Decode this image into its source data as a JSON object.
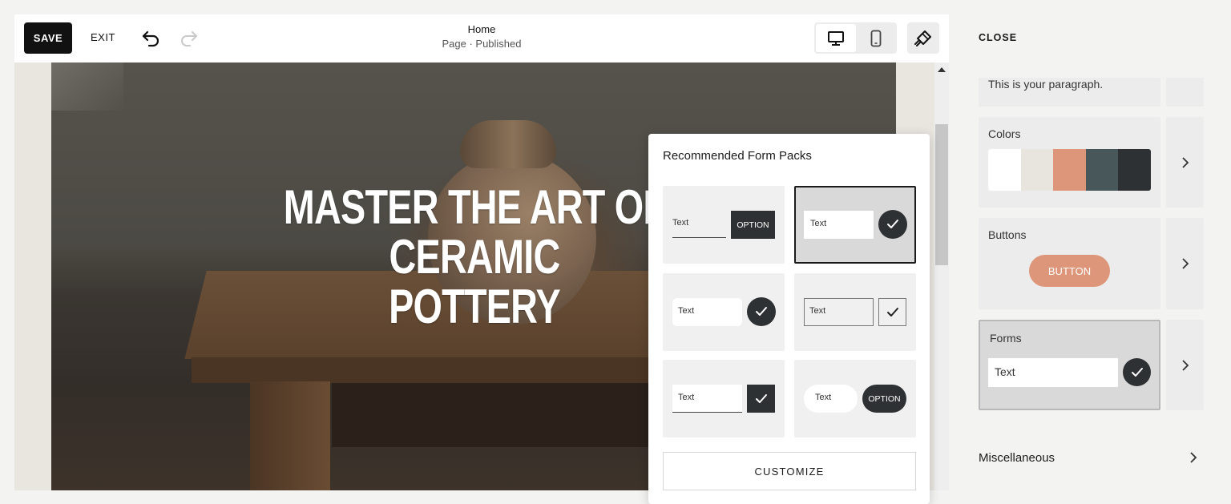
{
  "toolbar": {
    "save_label": "SAVE",
    "exit_label": "EXIT",
    "undo_icon": "undo-icon",
    "redo_icon": "redo-icon",
    "page_title": "Home",
    "page_status": "Page · Published",
    "desktop_icon": "desktop-icon",
    "mobile_icon": "mobile-icon",
    "design_icon": "paintbrush-icon"
  },
  "hero": {
    "heading_line1": "MASTER THE ART OF CERAMIC",
    "heading_line2": "POTTERY"
  },
  "form_packs": {
    "title": "Recommended Form Packs",
    "packs": [
      {
        "field_text": "Text",
        "action": "OPTION",
        "style": "underline-field, square option button"
      },
      {
        "field_text": "Text",
        "action": "check",
        "style": "box field, round check",
        "selected": true
      },
      {
        "field_text": "Text",
        "action": "check",
        "style": "rounded field, round check"
      },
      {
        "field_text": "Text",
        "action": "check",
        "style": "outlined field, outlined square check"
      },
      {
        "field_text": "Text",
        "action": "check",
        "style": "underline field, square dark check"
      },
      {
        "field_text": "Text",
        "action": "OPTION",
        "style": "pill field, pill option"
      }
    ],
    "customize_label": "CUSTOMIZE"
  },
  "panel": {
    "close_label": "CLOSE",
    "paragraph_text": "This is your paragraph.",
    "colors_label": "Colors",
    "colors": [
      "#ffffff",
      "#e8e5df",
      "#dd9679",
      "#48585a",
      "#2e3133"
    ],
    "buttons_label": "Buttons",
    "button_sample": "BUTTON",
    "forms_label": "Forms",
    "forms_field": "Text",
    "misc_label": "Miscellaneous"
  },
  "accent": {
    "dark": "#2e3133",
    "peach": "#dd9679"
  }
}
